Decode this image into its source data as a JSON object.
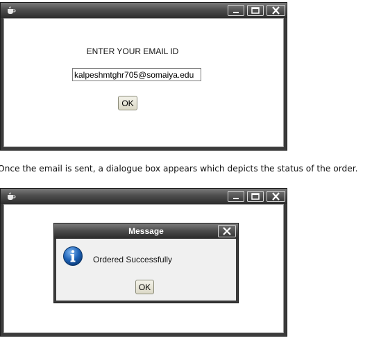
{
  "window1": {
    "prompt": "ENTER YOUR EMAIL ID",
    "email_value": "kalpeshmtghr705@somaiya.edu",
    "ok_label": "OK"
  },
  "caption": "Once the email is sent, a dialogue box appears which depicts the status of the order.",
  "window2": {
    "dialog": {
      "title": "Message",
      "message": "Ordered Successfully",
      "ok_label": "OK",
      "icon": "info-icon"
    }
  },
  "icons": {
    "app": "java-cup-icon",
    "minimize": "minimize-icon",
    "maximize": "maximize-icon",
    "close": "close-icon"
  },
  "colors": {
    "titlebar": "#3b3b3b",
    "info_blue": "#1e63b8",
    "button_face": "#e8e6d8"
  }
}
